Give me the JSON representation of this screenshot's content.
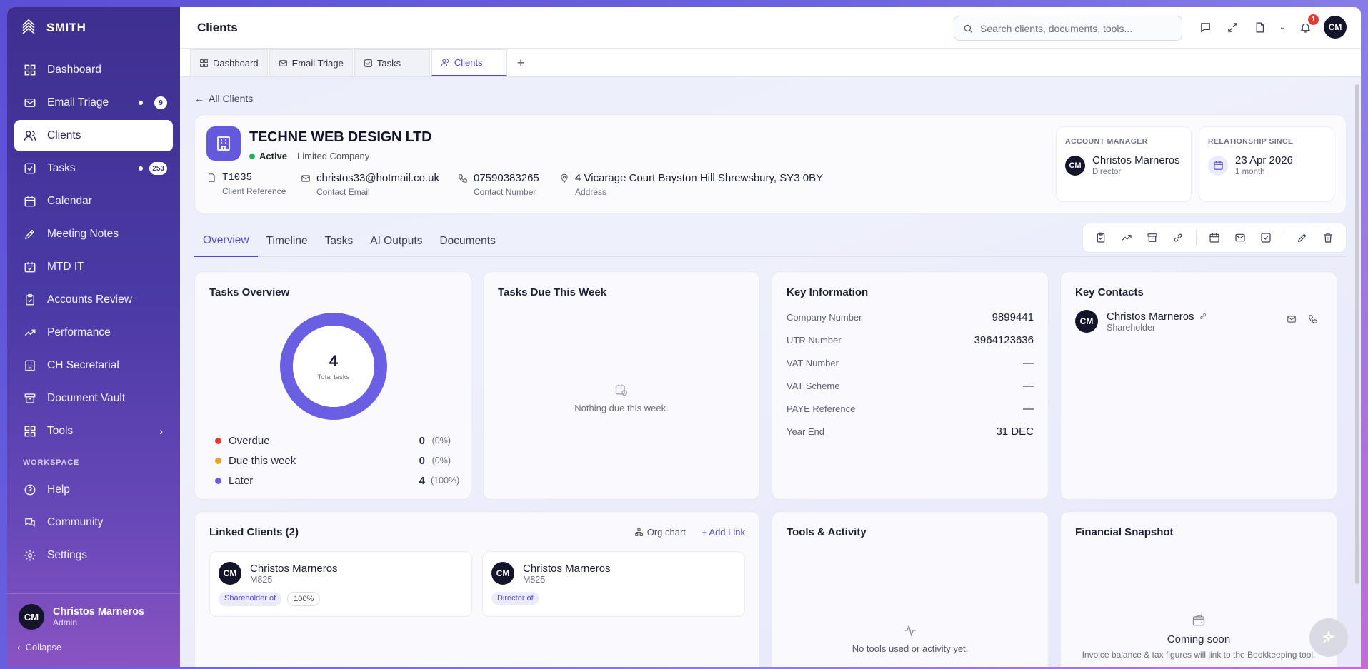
{
  "brand": {
    "name": "SMITH"
  },
  "sidebar": {
    "items": [
      {
        "label": "Dashboard",
        "icon": "grid-icon"
      },
      {
        "label": "Email Triage",
        "icon": "mail-icon",
        "badge": "9"
      },
      {
        "label": "Clients",
        "icon": "users-icon"
      },
      {
        "label": "Tasks",
        "icon": "checkbox-icon",
        "badge": "253"
      },
      {
        "label": "Calendar",
        "icon": "calendar-icon"
      },
      {
        "label": "Meeting Notes",
        "icon": "pen-icon"
      },
      {
        "label": "MTD IT",
        "icon": "calendar-check-icon"
      },
      {
        "label": "Accounts Review",
        "icon": "clipboard-icon"
      },
      {
        "label": "Performance",
        "icon": "trend-icon"
      },
      {
        "label": "CH Secretarial",
        "icon": "building-icon"
      },
      {
        "label": "Document Vault",
        "icon": "archive-icon"
      },
      {
        "label": "Tools",
        "icon": "grid-icon"
      }
    ],
    "workspace_label": "WORKSPACE",
    "workspace_items": [
      {
        "label": "Help",
        "icon": "help-icon"
      },
      {
        "label": "Community",
        "icon": "chat-icon"
      },
      {
        "label": "Settings",
        "icon": "gear-icon"
      }
    ],
    "user": {
      "initials": "CM",
      "name": "Christos Marneros",
      "role": "Admin"
    },
    "collapse_label": "Collapse"
  },
  "header": {
    "title": "Clients",
    "search_placeholder": "Search clients, documents, tools...",
    "notification_count": "1",
    "avatar_initials": "CM"
  },
  "window_tabs": [
    {
      "label": "Dashboard"
    },
    {
      "label": "Email Triage"
    },
    {
      "label": "Tasks"
    },
    {
      "label": "Clients"
    }
  ],
  "client": {
    "back_label": "All Clients",
    "name": "TECHNE WEB DESIGN LTD",
    "status": "Active",
    "type": "Limited Company",
    "reference": {
      "value": "T1035",
      "label": "Client Reference"
    },
    "email": {
      "value": "christos33@hotmail.co.uk",
      "label": "Contact Email"
    },
    "phone": {
      "value": "07590383265",
      "label": "Contact Number"
    },
    "address": {
      "value": "4 Vicarage Court Bayston Hill Shrewsbury, SY3 0BY",
      "label": "Address"
    },
    "account_manager": {
      "label": "ACCOUNT MANAGER",
      "initials": "CM",
      "name": "Christos Marneros",
      "role": "Director"
    },
    "relationship": {
      "label": "RELATIONSHIP SINCE",
      "date": "23 Apr 2026",
      "duration": "1 month"
    }
  },
  "subtabs": [
    "Overview",
    "Timeline",
    "Tasks",
    "AI Outputs",
    "Documents"
  ],
  "tasks_overview": {
    "title": "Tasks Overview",
    "total": "4",
    "total_label": "Total tasks",
    "legend": [
      {
        "label": "Overdue",
        "value": "0",
        "pct": "(0%)",
        "color": "#e53935"
      },
      {
        "label": "Due this week",
        "value": "0",
        "pct": "(0%)",
        "color": "#f0a020"
      },
      {
        "label": "Later",
        "value": "4",
        "pct": "(100%)",
        "color": "#6a5fe3"
      }
    ]
  },
  "tasks_due": {
    "title": "Tasks Due This Week",
    "empty": "Nothing due this week."
  },
  "key_info": {
    "title": "Key Information",
    "rows": [
      {
        "label": "Company Number",
        "value": "9899441"
      },
      {
        "label": "UTR Number",
        "value": "3964123636"
      },
      {
        "label": "VAT Number",
        "value": "—"
      },
      {
        "label": "VAT Scheme",
        "value": "—"
      },
      {
        "label": "PAYE Reference",
        "value": "—"
      },
      {
        "label": "Year End",
        "value": "31 DEC"
      }
    ]
  },
  "key_contacts": {
    "title": "Key Contacts",
    "contact": {
      "initials": "CM",
      "name": "Christos Marneros",
      "role": "Shareholder"
    }
  },
  "linked_clients": {
    "title": "Linked Clients (2)",
    "org_chart": "Org chart",
    "add_link": "Add Link",
    "items": [
      {
        "initials": "CM",
        "name": "Christos Marneros",
        "code": "M825",
        "role": "Shareholder of",
        "pct": "100%"
      },
      {
        "initials": "CM",
        "name": "Christos Marneros",
        "code": "M825",
        "role": "Director of"
      }
    ]
  },
  "tools_activity": {
    "title": "Tools & Activity",
    "empty": "No tools used or activity yet."
  },
  "financial_snapshot": {
    "title": "Financial Snapshot",
    "coming": "Coming soon",
    "sub": "Invoice balance & tax figures will link to the Bookkeeping tool."
  },
  "colors": {
    "accent": "#5347d4",
    "sidebar": "#4b3aa6"
  }
}
